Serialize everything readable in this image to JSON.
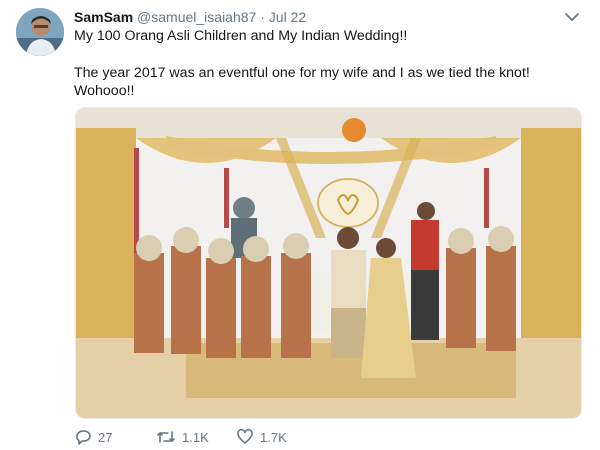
{
  "tweet": {
    "author_name": "SamSam",
    "handle": "@samuel_isaiah87",
    "separator": "·",
    "date": "Jul 22",
    "text_line1": "My 100 Orang Asli Children and My Indian Wedding!!",
    "text_line2": "The year 2017 was an eventful one for my wife and I as we tied the knot! Wohooo!!",
    "photo": {
      "description_icon": "wedding-photo",
      "subjects": [
        "bride",
        "groom",
        "woman-in-hijab",
        "man-in-red-shirt",
        "children-in-traditional-costume"
      ]
    },
    "replies": "27",
    "retweets": "1.1K",
    "likes": "1.7K"
  },
  "colors": {
    "text": "#14171a",
    "muted": "#657786",
    "border": "#e6ecf0",
    "drape_gold": "#d9b25a",
    "drape_white": "#f3f1ef"
  },
  "icons": {
    "caret": "chevron-down-icon",
    "reply": "reply-icon",
    "retweet": "retweet-icon",
    "like": "heart-icon"
  }
}
